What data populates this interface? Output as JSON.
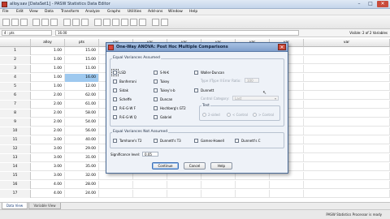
{
  "window": {
    "title": "alloy.sav [DataSet1] - PASW Statistics Data Editor",
    "controls": [
      "–",
      "□",
      "✕"
    ]
  },
  "menus": [
    "File",
    "Edit",
    "View",
    "Data",
    "Transform",
    "Analyze",
    "Graphs",
    "Utilities",
    "Add-ons",
    "Window",
    "Help"
  ],
  "cellbar": {
    "ref": "4 : pts",
    "value": "16.00",
    "visible": "Visible: 2 of 2 Variables"
  },
  "grid": {
    "columns": [
      "alloy",
      "pts",
      "var",
      "var",
      "var",
      "var",
      "var",
      "var",
      "var"
    ],
    "rows": [
      {
        "n": "1",
        "alloy": "1.00",
        "pts": "15.00"
      },
      {
        "n": "2",
        "alloy": "1.00",
        "pts": "15.00"
      },
      {
        "n": "3",
        "alloy": "1.00",
        "pts": "11.00"
      },
      {
        "n": "4",
        "alloy": "1.00",
        "pts": "16.00"
      },
      {
        "n": "5",
        "alloy": "1.00",
        "pts": "12.00"
      },
      {
        "n": "6",
        "alloy": "2.00",
        "pts": "62.00"
      },
      {
        "n": "7",
        "alloy": "2.00",
        "pts": "61.00"
      },
      {
        "n": "8",
        "alloy": "2.00",
        "pts": "58.00"
      },
      {
        "n": "9",
        "alloy": "2.00",
        "pts": "54.00"
      },
      {
        "n": "10",
        "alloy": "2.00",
        "pts": "56.00"
      },
      {
        "n": "11",
        "alloy": "3.00",
        "pts": "40.00"
      },
      {
        "n": "12",
        "alloy": "3.00",
        "pts": "29.00"
      },
      {
        "n": "13",
        "alloy": "3.00",
        "pts": "31.00"
      },
      {
        "n": "14",
        "alloy": "3.00",
        "pts": "35.00"
      },
      {
        "n": "15",
        "alloy": "3.00",
        "pts": "32.00"
      },
      {
        "n": "16",
        "alloy": "4.00",
        "pts": "28.00"
      },
      {
        "n": "17",
        "alloy": "4.00",
        "pts": "24.00"
      }
    ]
  },
  "tabs": {
    "data_view": "Data View",
    "variable_view": "Variable View"
  },
  "status": "PASW Statistics Processor is ready",
  "dialog": {
    "title": "One-Way ANOVA: Post Hoc Multiple Comparisons",
    "equal_group": "Equal Variances Assumed",
    "equal": {
      "col1": [
        "LSD",
        "Bonferroni",
        "Sidak",
        "Scheffe",
        "R-E-G-W F",
        "R-E-G-W Q"
      ],
      "col2": [
        "S-N-K",
        "Tukey",
        "Tukey's-b",
        "Duncan",
        "Hochberg's GT2",
        "Gabriel"
      ],
      "waller": "Waller-Duncan",
      "type_ratio_label": "Type I/Type II Error Ratio:",
      "type_ratio_value": "100",
      "dunnett": "Dunnett",
      "control_label": "Control Category:",
      "control_value": "Last",
      "test_label": "Test",
      "test_options": [
        "2-sided",
        "< Control",
        "> Control"
      ]
    },
    "unequal_group": "Equal Variances Not Assumed",
    "unequal": [
      "Tamhane's T2",
      "Dunnett's T3",
      "Games-Howell",
      "Dunnett's C"
    ],
    "significance_label": "Significance level:",
    "significance_value": "0.05",
    "buttons": {
      "continue": "Continue",
      "cancel": "Cancel",
      "help": "Help"
    }
  }
}
